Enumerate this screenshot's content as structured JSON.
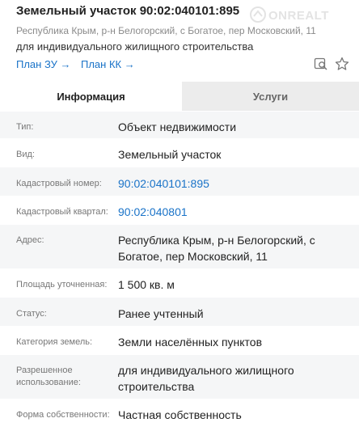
{
  "header": {
    "title": "Земельный участок 90:02:040101:895",
    "address": "Республика Крым, р-н Белогорский, с Богатое, пер Московский, 11",
    "purpose": "для индивидуального жилищного строительства",
    "link_zu": "План ЗУ →",
    "link_kk": "План КК →",
    "watermark": "ONREALT"
  },
  "tabs": {
    "info": "Информация",
    "services": "Услуги"
  },
  "rows": [
    {
      "label": "Тип:",
      "value": "Объект недвижимости"
    },
    {
      "label": "Вид:",
      "value": "Земельный участок"
    },
    {
      "label": "Кадастровый номер:",
      "value": "90:02:040101:895"
    },
    {
      "label": "Кадастровый квартал:",
      "value": "90:02:040801"
    },
    {
      "label": "Адрес:",
      "value": "Республика Крым, р-н Белогорский, с Богатое, пер Московский, 11"
    },
    {
      "label": "Площадь уточненная:",
      "value": "1 500 кв. м"
    },
    {
      "label": "Статус:",
      "value": "Ранее учтенный"
    },
    {
      "label": "Категория земель:",
      "value": "Земли населённых пунктов"
    },
    {
      "label": "Разрешенное использование:",
      "value": "для индивидуального жилищного строительства"
    },
    {
      "label": "Форма собственности:",
      "value": "Частная собственность"
    }
  ],
  "colors": {
    "link": "#1a73c8",
    "tab_inactive_bg": "#ececec",
    "row_alt_bg": "#f5f6f7"
  },
  "icons": [
    "search-map-icon",
    "star-icon"
  ]
}
